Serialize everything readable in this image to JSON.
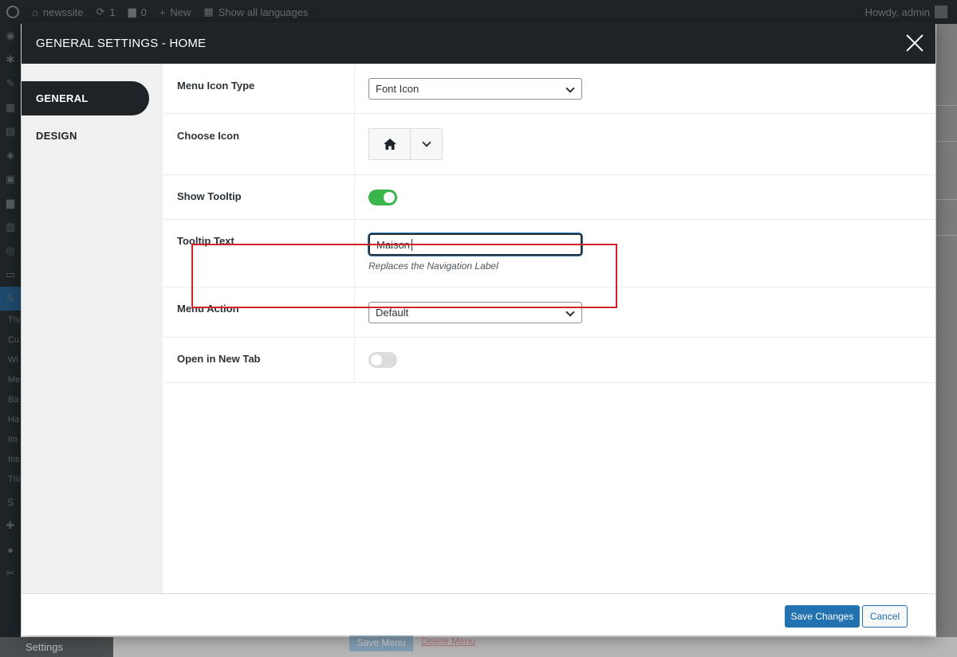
{
  "adminbar": {
    "site_name": "newssite",
    "updates_count": "1",
    "comments_count": "0",
    "new_label": "New",
    "languages_label": "Show all languages",
    "greeting": "Howdy, admin"
  },
  "adminmenu": {
    "submenu": [
      "Thi",
      "Cu",
      "Wi",
      "Me",
      "Ba",
      "Ha",
      "Im",
      "Ins",
      "Thi"
    ],
    "settings_label": "Settings",
    "save_menu_label": "Save Menu",
    "delete_menu_label": "Delete Menu"
  },
  "modal": {
    "title": "GENERAL SETTINGS - HOME",
    "tabs": [
      {
        "label": "GENERAL",
        "active": true
      },
      {
        "label": "DESIGN",
        "active": false
      }
    ],
    "fields": {
      "menu_icon_type": {
        "label": "Menu Icon Type",
        "value": "Font Icon",
        "icon": "chevron-down-icon"
      },
      "choose_icon": {
        "label": "Choose Icon",
        "icon": "home-icon"
      },
      "show_tooltip": {
        "label": "Show Tooltip",
        "on": true
      },
      "tooltip_text": {
        "label": "Tooltip Text",
        "value": "Maison",
        "help": "Replaces the Navigation Label"
      },
      "menu_action": {
        "label": "Menu Action",
        "value": "Default"
      },
      "open_new_tab": {
        "label": "Open in New Tab",
        "on": false
      }
    },
    "footer": {
      "save_label": "Save Changes",
      "cancel_label": "Cancel"
    },
    "colors": {
      "header_bg": "#1d2327",
      "primary": "#2271b1",
      "toggle_on": "#3bb54a",
      "highlight": "#d2232a"
    }
  }
}
